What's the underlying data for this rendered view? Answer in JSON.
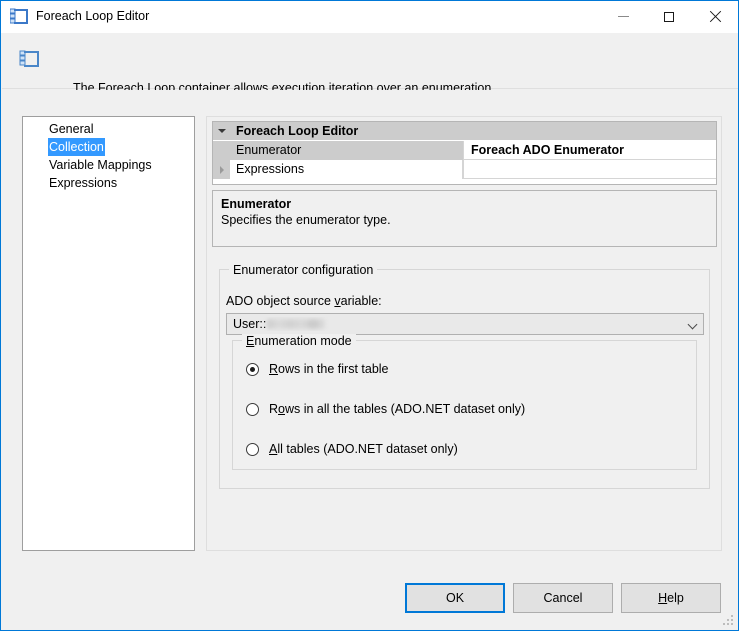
{
  "window": {
    "title": "Foreach Loop Editor",
    "icon": "foreach-loop-icon",
    "caption_buttons": {
      "minimize": "minimize-icon",
      "maximize": "maximize-icon",
      "close": "close-icon"
    }
  },
  "banner": {
    "icon": "foreach-loop-icon",
    "text": "The Foreach Loop container allows execution iteration over an enumeration."
  },
  "sidebar": {
    "items": [
      {
        "label": "General",
        "selected": false
      },
      {
        "label": "Collection",
        "selected": true
      },
      {
        "label": "Variable Mappings",
        "selected": false
      },
      {
        "label": "Expressions",
        "selected": false
      }
    ]
  },
  "property_grid": {
    "category": "Foreach Loop Editor",
    "rows": [
      {
        "label": "Enumerator",
        "value": "Foreach ADO Enumerator",
        "expandable": false
      },
      {
        "label": "Expressions",
        "value": "",
        "expandable": true
      }
    ]
  },
  "help_pane": {
    "title": "Enumerator",
    "description": "Specifies the enumerator type."
  },
  "enumerator_configuration": {
    "legend": "Enumerator configuration",
    "variable_label_pre": "ADO object source ",
    "variable_label_accel": "v",
    "variable_label_post": "ariable:",
    "variable_value_prefix": "User::",
    "variable_value_redacted": true,
    "enumeration_mode": {
      "legend_accel": "E",
      "legend_post": "numeration mode",
      "options": [
        {
          "pre": "",
          "accel": "R",
          "post": "ows in the first table",
          "checked": true
        },
        {
          "pre": "R",
          "accel": "o",
          "post": "ws in all the tables (ADO.NET dataset only)",
          "checked": false
        },
        {
          "pre": "",
          "accel": "A",
          "post": "ll tables (ADO.NET dataset only)",
          "checked": false
        }
      ]
    }
  },
  "footer": {
    "ok": "OK",
    "cancel": "Cancel",
    "help_accel": "H",
    "help_post": "elp"
  },
  "colors": {
    "window_border": "#0078d7",
    "accent": "#0078d7",
    "selection": "#3399ff",
    "dialog_background": "#f0f0f0",
    "grid_category": "#cccccc",
    "icon_blue": "#3b78c8"
  }
}
